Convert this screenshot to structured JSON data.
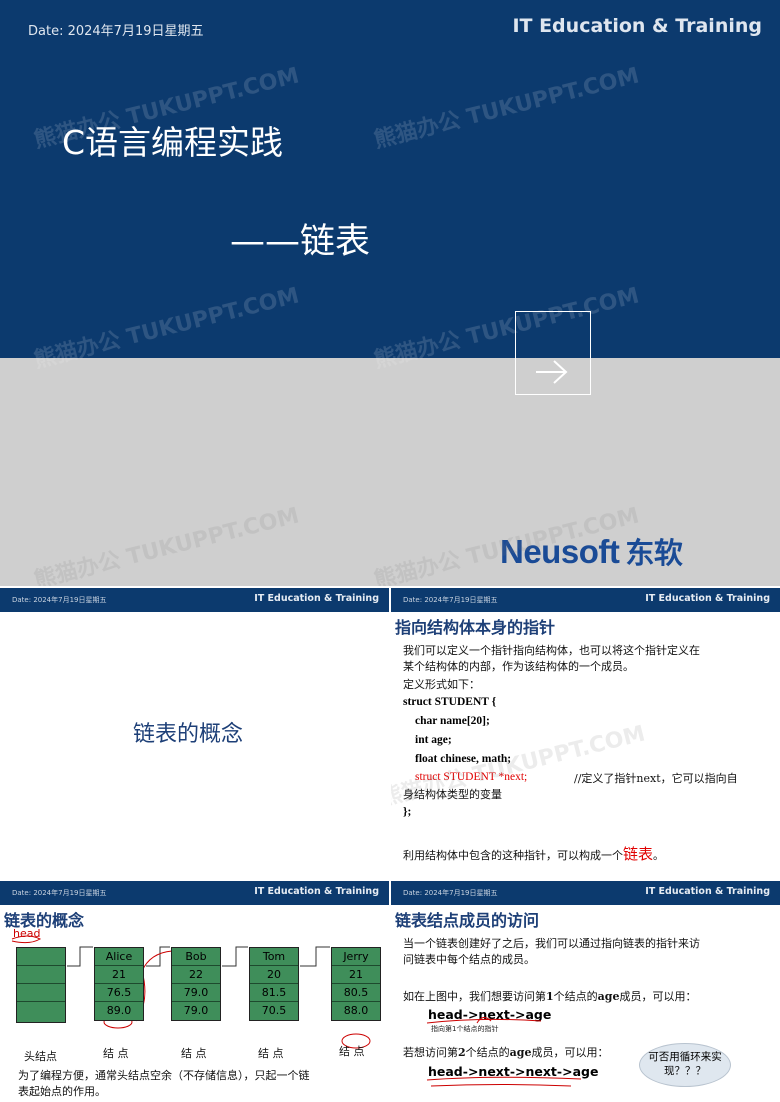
{
  "header": {
    "date": "Date: 2024年7月19日星期五",
    "brand": "IT Education & Training"
  },
  "cover": {
    "title": "C语言编程实践",
    "subtitle": "——链表",
    "logo_en": "Neusoft",
    "logo_cn": "东软"
  },
  "slide2": {
    "title": "链表的概念"
  },
  "slide3": {
    "title": "指向结构体本身的指针",
    "intro": [
      "我们可以定义一个指针指向结构体，也可以将这个指针定义在",
      "某个结构体的内部，作为该结构体的一个成员。",
      "定义形式如下："
    ],
    "code": [
      "struct  STUDENT {",
      "char  name[20];",
      "int     age;",
      "float  chinese, math;"
    ],
    "code_red": "struct  STUDENT   *next;",
    "comment": "//定义了指针next，它可以指向自",
    "comment2": "身结构体类型的变量",
    "close": "};",
    "summary": "利用结构体中包含的这种指针，可以构成一个",
    "summary_em": "链表",
    "summary_end": "。"
  },
  "slide4": {
    "title": "链表的概念",
    "head_label": "head",
    "nodes": [
      {
        "name": "Alice",
        "age": "21",
        "chinese": "76.5",
        "math": "89.0"
      },
      {
        "name": "Bob",
        "age": "22",
        "chinese": "79.0",
        "math": "79.0"
      },
      {
        "name": "Tom",
        "age": "20",
        "chinese": "81.5",
        "math": "70.5"
      },
      {
        "name": "Jerry",
        "age": "21",
        "chinese": "80.5",
        "math": "88.0"
      }
    ],
    "head_node_label": "头结点",
    "node_label": "结  点",
    "footer": [
      "为了编程方便，通常头结点空余（不存储信息），只起一个链",
      "表起始点的作用。"
    ]
  },
  "slide5": {
    "title": "链表结点成员的访问",
    "p1": [
      "当一个链表创建好了之后，我们可以通过指向链表的指针来访",
      "问链表中每个结点的成员。"
    ],
    "p2_a": "如在上图中，我们想要访问第",
    "p2_num": "1",
    "p2_b": "个结点的",
    "p2_field": "age",
    "p2_c": "成员，可以用：",
    "expr1": "head->next->age",
    "note1": "指向第1个结点的指针",
    "p3_a": "若想访问第",
    "p3_num": "2",
    "p3_b": "个结点的",
    "p3_field": "age",
    "p3_c": "成员，可以用：",
    "expr2": "head->next->next->age",
    "bubble": [
      "可否用循环来实",
      "现？？？"
    ]
  },
  "watermark": "熊猫办公 TUKUPPT.COM",
  "colors": {
    "navy": "#0c3a6e",
    "accent_red": "#e00000",
    "node_green": "#3f8e5a",
    "logo_blue": "#1a4b96"
  },
  "icons": {
    "next": "arrow-right-icon"
  }
}
